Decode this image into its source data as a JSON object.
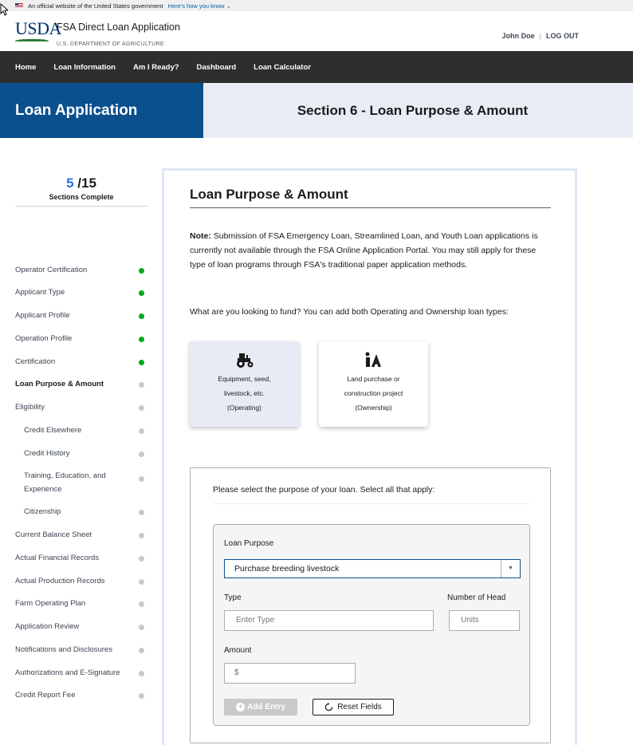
{
  "gov_banner": {
    "text": "An official website of the United States government",
    "link": "Here's how you know ⌄"
  },
  "header": {
    "logo_text": "USDA",
    "app_title": "FSA Direct Loan Application",
    "department": "U.S. DEPARTMENT OF AGRICULTURE",
    "user_name": "John Doe",
    "separator": "|",
    "logout": "LOG OUT"
  },
  "nav": {
    "items": [
      "Home",
      "Loan Information",
      "Am I Ready?",
      "Dashboard",
      "Loan Calculator"
    ]
  },
  "hero": {
    "left": "Loan Application",
    "right": "Section 6 - Loan Purpose & Amount"
  },
  "sidebar": {
    "progress_done": "5",
    "progress_total": " /15",
    "progress_label": "Sections Complete",
    "status_colors": {
      "complete": "#00a91c",
      "incomplete": "#c9c9c9"
    },
    "steps": [
      {
        "label": "Operator Certification",
        "status": "complete"
      },
      {
        "label": "Applicant Type",
        "status": "complete"
      },
      {
        "label": "Applicant Profile",
        "status": "complete"
      },
      {
        "label": "Operation Profile",
        "status": "complete"
      },
      {
        "label": "Certification",
        "status": "complete"
      },
      {
        "label": "Loan Purpose & Amount",
        "status": "current"
      },
      {
        "label": "Eligibility",
        "status": "incomplete"
      },
      {
        "label": "Credit Elsewhere",
        "status": "incomplete"
      },
      {
        "label": "Credit History",
        "status": "incomplete"
      },
      {
        "label": "Training, Education, and Experience",
        "status": "incomplete"
      },
      {
        "label": "Citizenship",
        "status": "incomplete"
      },
      {
        "label": "Current Balance Sheet",
        "status": "incomplete"
      },
      {
        "label": "Actual Financial Records",
        "status": "incomplete"
      },
      {
        "label": "Actual Production Records",
        "status": "incomplete"
      },
      {
        "label": "Farm Operating Plan",
        "status": "incomplete"
      },
      {
        "label": "Application Review",
        "status": "incomplete"
      },
      {
        "label": "Notifications and Disclosures",
        "status": "incomplete"
      },
      {
        "label": "Authorizations and E-Signature",
        "status": "incomplete"
      },
      {
        "label": "Credit Report Fee",
        "status": "incomplete"
      }
    ]
  },
  "main": {
    "title": "Loan Purpose & Amount",
    "note_label": "Note:",
    "note_text": " Submission of FSA Emergency Loan, Streamlined Loan, and Youth Loan applications is currently not available through the FSA Online Application Portal. You may still apply for these type of loan programs through FSA's traditional paper application methods.",
    "fund_question": "What are you looking to fund? You can add both Operating and Ownership loan types:",
    "choices": [
      {
        "icon": "tractor-icon",
        "line1": "Equipment, seed,",
        "line2": "livestock, etc.",
        "line3": "(Operating)",
        "selected": true
      },
      {
        "icon": "land-house-icon",
        "line1": "Land purchase or",
        "line2": "construction project",
        "line3": "(Ownership)",
        "selected": false
      }
    ],
    "purpose_question": "Please select the purpose of your loan. Select all that apply:",
    "form": {
      "loan_purpose_label": "Loan Purpose",
      "loan_purpose_value": "Purchase breeding livestock",
      "type_label": "Type",
      "type_placeholder": "Enter Type",
      "head_label": "Number of Head",
      "head_placeholder": "Units",
      "amount_label": "Amount",
      "amount_placeholder": "$",
      "add_button": "Add Entry",
      "reset_button": "Reset Fields"
    }
  }
}
